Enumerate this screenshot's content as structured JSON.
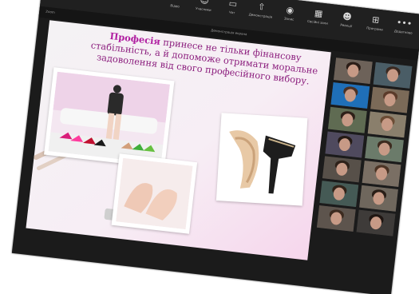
{
  "window": {
    "title_left": "Zoom",
    "title_center": "Демонстрація екрана"
  },
  "toolbar": {
    "items": [
      {
        "icon": "video-icon",
        "glyph": "▬",
        "label": "Відео"
      },
      {
        "icon": "participants-icon",
        "glyph": "☺",
        "label": "Учасники"
      },
      {
        "icon": "chat-icon",
        "glyph": "▭",
        "label": "Чат"
      },
      {
        "icon": "share-icon",
        "glyph": "⇧",
        "label": "Демонстрація"
      },
      {
        "icon": "record-icon",
        "glyph": "◉",
        "label": "Запис"
      },
      {
        "icon": "breakout-icon",
        "glyph": "▦",
        "label": "Сесійні зали"
      },
      {
        "icon": "reactions-icon",
        "glyph": "☻",
        "label": "Реакції"
      },
      {
        "icon": "apps-icon",
        "glyph": "⊞",
        "label": "Програми"
      },
      {
        "icon": "more-icon",
        "glyph": "•••",
        "label": "Додатково"
      }
    ]
  },
  "slide": {
    "title_word": "Професія",
    "text": "принесе не тільки фінансову стабільність, а й допоможе отримати моральне задоволення від свого професійного вибору."
  },
  "gallery": {
    "participants": [
      {
        "bg": "#6d6259",
        "hair": "#2b1d17"
      },
      {
        "bg": "#4a5d66",
        "hair": "#3a2a22"
      },
      {
        "bg": "#1f6fb8",
        "hair": "#4a3125"
      },
      {
        "bg": "#7b6a58",
        "hair": "#5b3b2a"
      },
      {
        "bg": "#5f6b52",
        "hair": "#2e2018"
      },
      {
        "bg": "#8a7f6c",
        "hair": "#6b4c35"
      },
      {
        "bg": "#4f4a5e",
        "hair": "#241a15"
      },
      {
        "bg": "#6b7b6a",
        "hair": "#3d2b1f"
      },
      {
        "bg": "#575049",
        "hair": "#2f221a"
      },
      {
        "bg": "#7a6f64",
        "hair": "#4b3324"
      },
      {
        "bg": "#455a55",
        "hair": "#312319"
      },
      {
        "bg": "#6f675d",
        "hair": "#2a1e17"
      },
      {
        "bg": "#5d544d",
        "hair": "#3c2a1f"
      },
      {
        "bg": "#3e3b39",
        "hair": "#1f1612"
      }
    ]
  }
}
